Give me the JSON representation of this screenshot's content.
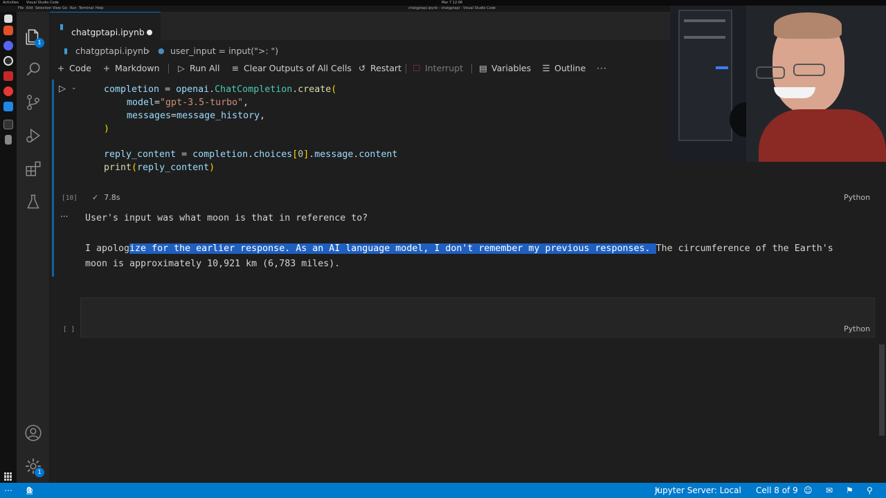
{
  "os": {
    "activities": "Activities",
    "app": "Visual Studio Code",
    "clock": "Mar 7  12:06"
  },
  "menu": {
    "items": [
      "File",
      "Edit",
      "Selection",
      "View",
      "Go",
      "Run",
      "Terminal",
      "Help"
    ],
    "window_title": "chatgptapi.ipynb - chatgptapi - Visual Studio Code"
  },
  "activity_bar": {
    "explorer_badge": "1",
    "settings_badge": "1"
  },
  "tab": {
    "label": "chatgptapi.ipynb"
  },
  "breadcrumb": {
    "file": "chatgptapi.ipynb",
    "symbol": "user_input = input(\">: \")"
  },
  "toolbar": {
    "code": "Code",
    "markdown": "Markdown",
    "run_all": "Run All",
    "clear_outputs": "Clear Outputs of All Cells",
    "restart": "Restart",
    "interrupt": "Interrupt",
    "variables": "Variables",
    "outline": "Outline",
    "more": "···"
  },
  "cell10": {
    "exec_count": "[10]",
    "duration": "7.8s",
    "language": "Python",
    "code": {
      "line1_var": "completion",
      "line1_eq": " = ",
      "line1_mod": "openai",
      "line1_dot": ".",
      "line1_cls": "ChatCompletion",
      "line1_dot2": ".",
      "line1_fn": "create",
      "line1_paren": "(",
      "line2_kw": "model",
      "line2_eq": "=",
      "line2_str": "\"gpt-3.5-turbo\"",
      "line2_comma": ",",
      "line3_kw": "messages",
      "line3_eq": "=",
      "line3_val": "message_history",
      "line3_comma": ",",
      "line4_paren": ")",
      "line6_var": "reply_content",
      "line6_eq": " = ",
      "line6_a": "completion",
      "line6_b": ".",
      "line6_c": "choices",
      "line6_lb": "[",
      "line6_n": "0",
      "line6_rb": "]",
      "line6_d": ".",
      "line6_e": "message",
      "line6_f": ".",
      "line6_g": "content",
      "line7_fn": "print",
      "line7_lp": "(",
      "line7_arg": "reply_content",
      "line7_rp": ")"
    },
    "output": {
      "line1": "User's input was what moon is that in reference to?",
      "line2_pre": "I apolog",
      "line2_sel_a": "ize for the earlier response. As an AI language model, I don't remember my previous responses. ",
      "line2_post": "The circumference of the Earth's",
      "line3": "moon is approximately 10,921 km (6,783 miles)."
    }
  },
  "empty_cell": {
    "exec_count": "[ ]",
    "language": "Python"
  },
  "statusbar": {
    "errors": "0",
    "warnings": "0",
    "jupyter": "Jupyter Server: Local",
    "cell_pos": "Cell 8 of 9"
  }
}
